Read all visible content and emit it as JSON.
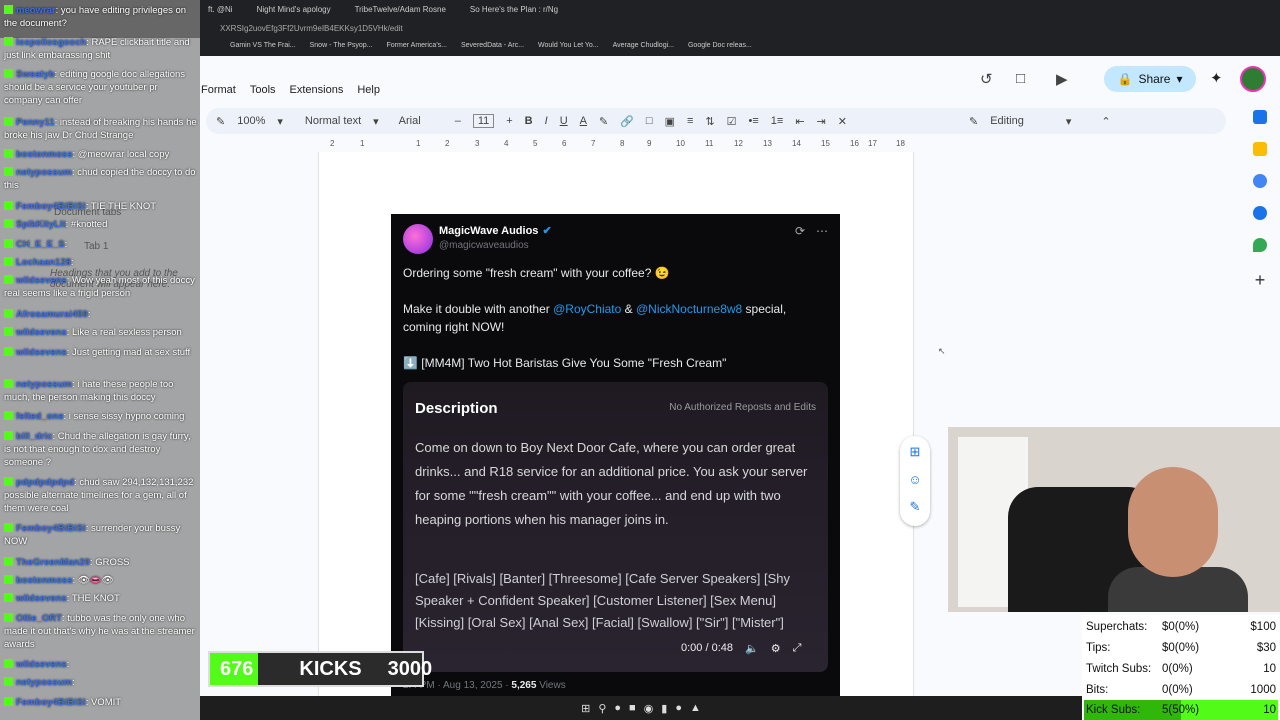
{
  "browser": {
    "tabs": [
      "ft. @Ni",
      "Night Mind's apology",
      "TribeTwelve/Adam Rosne",
      "So Here's the Plan : r/Ng"
    ],
    "url": "XXRSIg2uovEfg3Ff2Uvrm9eIB4EKKsy1D5VHk/edit",
    "bookmarks": [
      "Gamin VS The Frai...",
      "Snow - The Psyop...",
      "Former America's...",
      "SeveredData - Arc...",
      "Would You Let Yo...",
      "Average Chudlogi...",
      "Google Doc releas..."
    ]
  },
  "docs": {
    "menu": [
      "Format",
      "Tools",
      "Extensions",
      "Help"
    ],
    "share_label": "Share",
    "zoom": "100%",
    "style": "Normal text",
    "font": "Arial",
    "font_size": "11",
    "mode": "Editing",
    "ruler": [
      "2",
      "1",
      "1",
      "2",
      "3",
      "4",
      "5",
      "6",
      "7",
      "8",
      "9",
      "10",
      "11",
      "12",
      "13",
      "14",
      "15",
      "16",
      "17",
      "18"
    ],
    "doc_tabs_label": "Document tabs",
    "tab1": "Tab 1",
    "outline_hint": "Headings that you add to the document will appear here."
  },
  "tweet": {
    "name": "MagicWave Audios",
    "handle": "@magicwaveaudios",
    "line1": "Ordering some \"fresh cream\" with your coffee? 😉",
    "line2a": "Make it double with another ",
    "mention1": "@RoyChiato",
    "amp": " & ",
    "mention2": "@NickNocturne8w8",
    "line2b": " special,",
    "line3": "coming right NOW!",
    "line4": "⬇️ [MM4M] Two Hot Baristas Give You Some \"Fresh Cream\"",
    "desc_title": "Description",
    "desc_note": "No Authorized Reposts and Edits",
    "desc_body": "Come on down to Boy Next Door Cafe, where you can order great drinks... and R18 service for an additional price. You ask your server for some \"\"fresh cream\"\" with your coffee... and end up with two heaping portions when his manager joins in.",
    "desc_tags": "[Cafe] [Rivals] [Banter] [Threesome] [Cafe Server Speakers] [Shy Speaker + Confident Speaker] [Customer Listener] [Sex Menu] [Kissing] [Oral Sex] [Anal Sex] [Facial] [Swallow] [\"Sir\"] [\"Mister\"]",
    "video_time": "0:00 / 0:48",
    "meta_time": "2:4 PM · Aug 13, 2025 · ",
    "views_count": "5,265",
    "views_label": " Views"
  },
  "chat": [
    {
      "user": "meowrar",
      "text": "you have editing privileges on the document?"
    },
    {
      "user": "lospollosgooch",
      "text": "RAPE clickbait title and just link embarassing shit"
    },
    {
      "user": "Sweatyb",
      "text": "editing google doc allegations should be a service your youtuber pr company can offer"
    },
    {
      "user": "Penny11",
      "text": "instead of breaking his hands he broke his jaw Dr Chud Strange"
    },
    {
      "user": "bostonmoss",
      "text": "@meowrar local copy"
    },
    {
      "user": "netypossum",
      "text": "chud copied the doccy to do this"
    },
    {
      "user": "Femboy4BiBiSi",
      "text": "TIE THE KNOT"
    },
    {
      "user": "SpikKityLit",
      "text": "#knotted"
    },
    {
      "user": "CH_E_E_S",
      "text": ""
    },
    {
      "user": "Lochaan128",
      "text": ""
    },
    {
      "user": "wildsevens",
      "text": "Wow yeah most of this doccy real seems like a frigid person"
    },
    {
      "user": "Afrosamurai459",
      "text": ""
    },
    {
      "user": "wildsevens",
      "text": "Like a real sexless person"
    },
    {
      "user": "wildsevens",
      "text": "Just getting mad at sex stuff"
    },
    {
      "user": "netypossum",
      "text": "i hate these people too much, the person making this doccy"
    },
    {
      "user": "felted_one",
      "text": "i sense sissy hypno coming"
    },
    {
      "user": "bill_dric",
      "text": "Chud the allegation is gay furry, is not that enough to dox and destroy someone ?"
    },
    {
      "user": "pdpdpdpdpd",
      "text": "chud saw 294,132,131,232 possible alternate timelines for a gem, all of them were coal"
    },
    {
      "user": "Femboy4BiBiSi",
      "text": "surrender your bussy NOW"
    },
    {
      "user": "TheGreenMan20",
      "text": "GROSS"
    },
    {
      "user": "bostonmoss",
      "text": "👁👄👁"
    },
    {
      "user": "wildsevens",
      "text": "THE KNOT"
    },
    {
      "user": "Ollie_ORT",
      "text": "tubbo was the only one who made it out that's why he was at the streamer awards"
    },
    {
      "user": "wildsevens",
      "text": ""
    },
    {
      "user": "netypossum",
      "text": ""
    },
    {
      "user": "Femboy4BiBiSi",
      "text": "VOMIT"
    }
  ],
  "kicks": {
    "count": "676",
    "label": "KICKS",
    "goal": "3000",
    "progress": 0.225
  },
  "stats": [
    {
      "label": "Superchats:",
      "value": "$0(0%)",
      "max": "$100"
    },
    {
      "label": "Tips:",
      "value": "$0(0%)",
      "max": "$30"
    },
    {
      "label": "Twitch Subs:",
      "value": "0(0%)",
      "max": "10"
    },
    {
      "label": "Bits:",
      "value": "0(0%)",
      "max": "1000"
    },
    {
      "label": "Kick Subs:",
      "value": "5(50%)",
      "max": "10"
    }
  ]
}
